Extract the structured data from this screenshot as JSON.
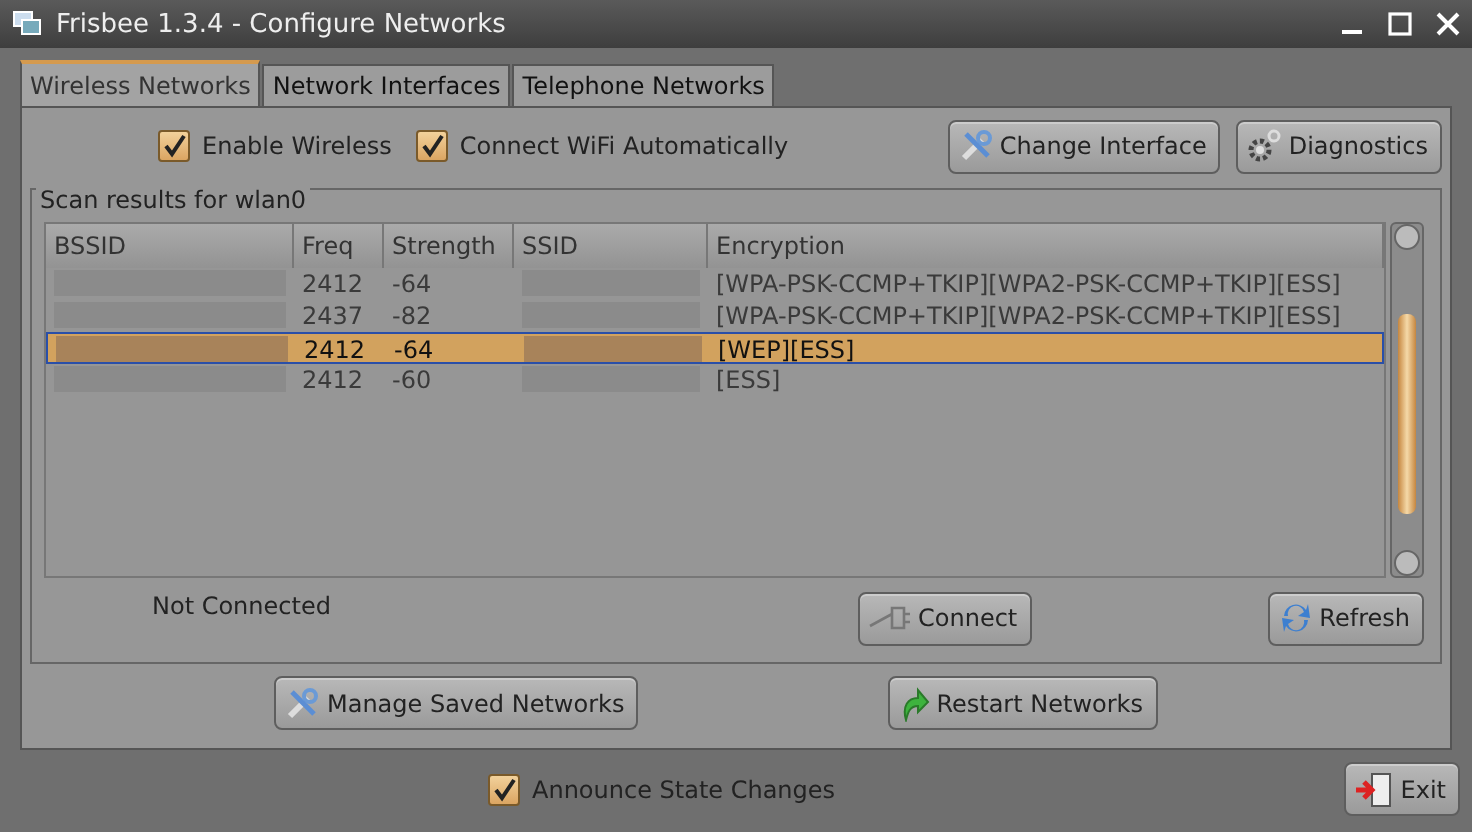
{
  "window": {
    "title": "Frisbee 1.3.4 - Configure Networks"
  },
  "tabs": [
    {
      "label": "Wireless Networks",
      "selected": true
    },
    {
      "label": "Network Interfaces",
      "selected": false
    },
    {
      "label": "Telephone Networks",
      "selected": false
    }
  ],
  "options": [
    {
      "label": "Enable Wireless",
      "checked": true
    },
    {
      "label": "Connect WiFi Automatically",
      "checked": true
    }
  ],
  "top_buttons": [
    "Change Interface",
    "Diagnostics"
  ],
  "scan_results": {
    "title": "Scan results for wlan0",
    "columns": [
      "BSSID",
      "Freq",
      "Strength",
      "SSID",
      "Encryption"
    ],
    "rows": [
      {
        "freq": "2412",
        "strength": "-64",
        "encryption": "[WPA-PSK-CCMP+TKIP][WPA2-PSK-CCMP+TKIP][ESS]",
        "selected": false
      },
      {
        "freq": "2437",
        "strength": "-82",
        "encryption": "[WPA-PSK-CCMP+TKIP][WPA2-PSK-CCMP+TKIP][ESS]",
        "selected": false
      },
      {
        "freq": "2412",
        "strength": "-64",
        "encryption": "[WEP][ESS]",
        "selected": true
      },
      {
        "freq": "2412",
        "strength": "-60",
        "encryption": "[ESS]",
        "selected": false
      }
    ]
  },
  "status": "Not Connected",
  "scan_buttons": [
    "Connect",
    "Refresh"
  ],
  "bottom_buttons": [
    "Manage Saved Networks",
    "Restart Networks"
  ],
  "footer": {
    "announce": {
      "label": "Announce State Changes",
      "checked": true
    },
    "exit": "Exit"
  }
}
